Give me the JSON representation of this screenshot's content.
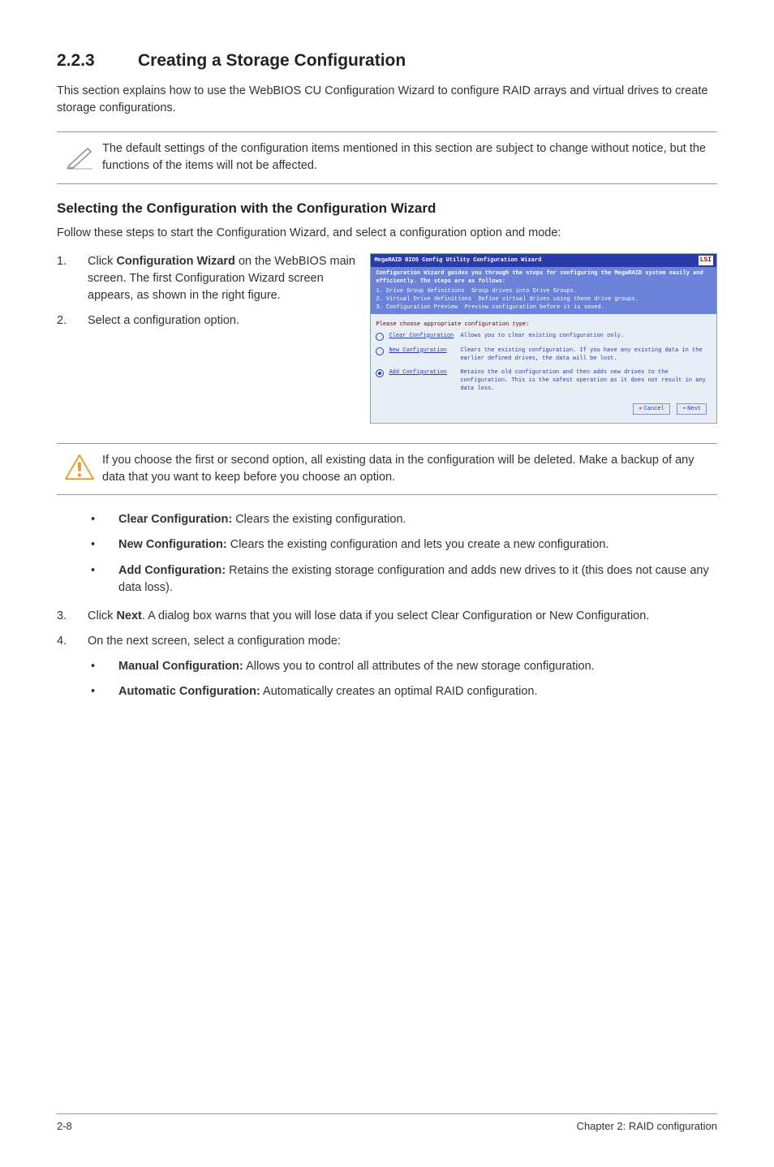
{
  "section": {
    "number": "2.2.3",
    "title": "Creating a Storage Configuration"
  },
  "intro": "This section explains how to use the WebBIOS CU Configuration Wizard to configure RAID arrays and virtual drives to create storage configurations.",
  "note": "The default settings of the configuration items mentioned in this section are subject to change without notice, but the functions of the items will not be affected.",
  "subheading": "Selecting the Configuration with the Configuration Wizard",
  "subintro": "Follow these steps to start the Configuration Wizard, and select a configuration option and mode:",
  "steps12": [
    {
      "n": "1.",
      "pre": "Click ",
      "bold": "Configuration Wizard",
      "post": " on the WebBIOS main screen. The first Configuration Wizard screen appears, as shown in the right figure."
    },
    {
      "n": "2.",
      "pre": "Select a configuration option.",
      "bold": "",
      "post": ""
    }
  ],
  "warning": "If you choose the first or second option, all existing data in the configuration will be deleted. Make a backup of any data that you want to keep before you choose an option.",
  "options": [
    {
      "bold": "Clear Configuration:",
      "text": " Clears the existing configuration."
    },
    {
      "bold": "New Configuration:",
      "text": " Clears the existing configuration and lets you create a new configuration."
    },
    {
      "bold": "Add Configuration:",
      "text": " Retains the existing storage configuration and adds new drives to it (this does not cause any data loss)."
    }
  ],
  "step3": {
    "n": "3.",
    "pre": "Click ",
    "bold": "Next",
    "post": ". A dialog box warns that you will lose data if you select Clear Configuration or New Configuration."
  },
  "step4": {
    "n": "4.",
    "text": "On the next screen, select a configuration mode:"
  },
  "modes": [
    {
      "bold": "Manual Configuration:",
      "text": " Allows you to control all attributes of the new storage configuration."
    },
    {
      "bold": "Automatic Configuration:",
      "text": " Automatically creates an optimal RAID configuration."
    }
  ],
  "footer": {
    "left": "2-8",
    "right": "Chapter 2: RAID configuration"
  },
  "screenshot": {
    "title": "MegaRAID BIOS Config Utility Configuration Wizard",
    "logo": "LSI",
    "band1": "Configuration Wizard guides you through the steps for configuring the MegaRAID system easily and efficiently. The steps are as follows:",
    "lines": [
      {
        "a": "1. Drive Group definitions",
        "b": "Group drives into Drive Groups."
      },
      {
        "a": "2. Virtual Drive definitions",
        "b": "Define virtual drives using those drive groups."
      },
      {
        "a": "3. Configuration Preview",
        "b": "Preview configuration before it is saved."
      }
    ],
    "hint": "Please choose appropriate configuration type:",
    "opts": [
      {
        "label": "Clear Configuration",
        "desc": "Allows you to clear existing configuration only.",
        "selected": false
      },
      {
        "label": "New Configuration",
        "desc": "Clears the existing configuration. If you have any existing data in the earlier defined drives, the data will be lost.",
        "selected": false
      },
      {
        "label": "Add Configuration",
        "desc": "Retains the old configuration and then adds new drives to the configuration. This is the safest operation as it does not result in any data loss.",
        "selected": true
      }
    ],
    "cancel": "Cancel",
    "next": "Next"
  }
}
